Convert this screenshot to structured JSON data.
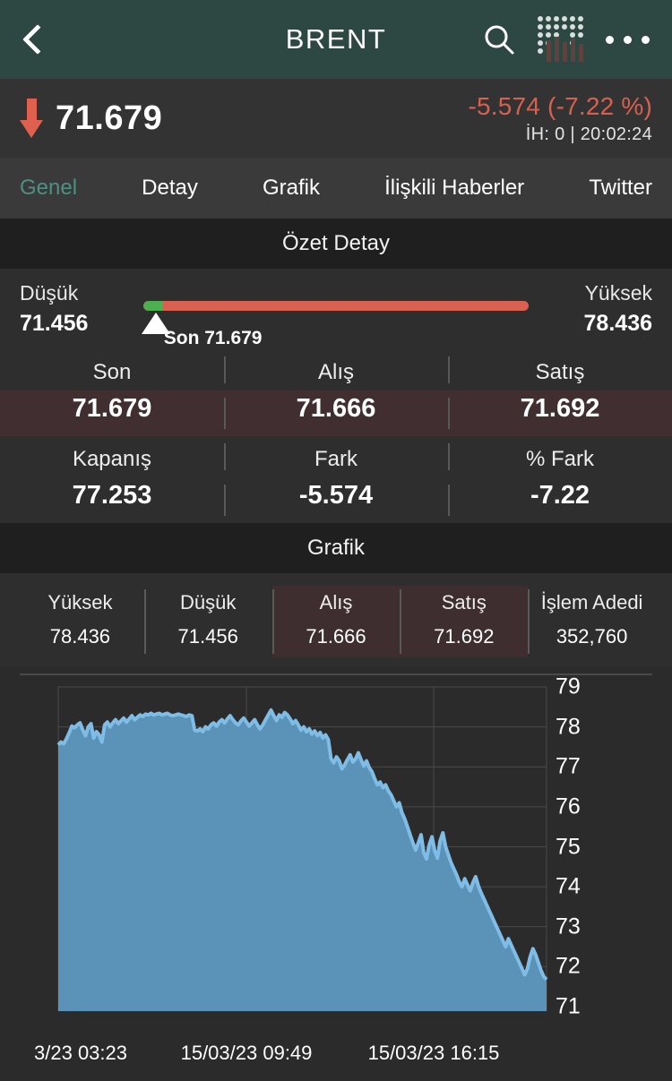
{
  "topbar": {
    "title": "BRENT",
    "back_icon": "chevron-left-icon",
    "search_icon": "search-icon",
    "grid_icon": "matrix-board-icon",
    "more_icon": "more-options-icon"
  },
  "price": {
    "direction_icon": "arrow-down-icon",
    "last": "71.679",
    "change": "-5.574 (-7.22 %)",
    "status": "İH:  0 | 20:02:24",
    "down_color": "#d9604f"
  },
  "tabs": [
    {
      "label": "Genel",
      "active": true
    },
    {
      "label": "Detay",
      "active": false
    },
    {
      "label": "Grafik",
      "active": false
    },
    {
      "label": "İlişkili Haberler",
      "active": false
    },
    {
      "label": "Twitter",
      "active": false
    }
  ],
  "sections": {
    "summary_title": "Özet Detay",
    "chart_title": "Grafik"
  },
  "range": {
    "low_label": "Düşük",
    "low_value": "71.456",
    "high_label": "Yüksek",
    "high_value": "78.436",
    "marker_label": "Son 71.679",
    "marker_percent": 3.2,
    "green_percent": 5,
    "bar_color": "#d96152",
    "green_color": "#4caf50"
  },
  "summary_grid": {
    "row1": [
      {
        "label": "Son",
        "value": "71.679"
      },
      {
        "label": "Alış",
        "value": "71.666"
      },
      {
        "label": "Satış",
        "value": "71.692"
      }
    ],
    "row2": [
      {
        "label": "Kapanış",
        "value": "77.253"
      },
      {
        "label": "Fark",
        "value": "-5.574"
      },
      {
        "label": "% Fark",
        "value": "-7.22"
      }
    ]
  },
  "chart_stats": [
    {
      "label": "Yüksek",
      "value": "78.436",
      "highlight": false
    },
    {
      "label": "Düşük",
      "value": "71.456",
      "highlight": false
    },
    {
      "label": "Alış",
      "value": "71.666",
      "highlight": true
    },
    {
      "label": "Satış",
      "value": "71.692",
      "highlight": true
    },
    {
      "label": "İşlem Adedi",
      "value": "352,760",
      "highlight": false
    }
  ],
  "chart_data": {
    "type": "area",
    "title": "Grafik",
    "xlabel": "",
    "ylabel": "",
    "ylim": [
      70.6,
      79.3
    ],
    "yticks": [
      79,
      78,
      77,
      76,
      75,
      74,
      73,
      72,
      71
    ],
    "ytick_labels": [
      "79",
      "78",
      "77",
      "76",
      "75",
      "74",
      "73",
      "72",
      "71"
    ],
    "xtick_labels": [
      "3/23 03:23",
      "15/03/23 09:49",
      "15/03/23 16:15"
    ],
    "xtick_positions": [
      90,
      275,
      484
    ],
    "grid": true,
    "line_color": "#7fbde6",
    "fill_color": "#5a92b8",
    "series": [
      {
        "name": "BRENT",
        "values": [
          77.55,
          77.62,
          77.58,
          77.7,
          77.85,
          78.02,
          77.98,
          78.05,
          78.1,
          77.92,
          77.78,
          78.0,
          78.08,
          77.72,
          77.88,
          77.8,
          77.62,
          78.05,
          78.12,
          78.0,
          78.1,
          78.18,
          78.08,
          78.15,
          78.22,
          78.12,
          78.2,
          78.28,
          78.18,
          78.24,
          78.3,
          78.26,
          78.32,
          78.3,
          78.34,
          78.3,
          78.32,
          78.34,
          78.3,
          78.32,
          78.34,
          78.3,
          78.28,
          78.3,
          78.32,
          78.3,
          78.28,
          78.26,
          78.3,
          78.28,
          77.92,
          77.9,
          77.95,
          77.88,
          78.0,
          77.95,
          78.05,
          78.1,
          78.02,
          78.12,
          78.18,
          78.1,
          78.2,
          78.28,
          78.18,
          78.1,
          78.05,
          78.15,
          78.22,
          78.12,
          78.02,
          78.1,
          78.18,
          78.05,
          77.95,
          78.05,
          78.18,
          78.3,
          78.42,
          78.28,
          78.16,
          78.3,
          78.24,
          78.36,
          78.3,
          78.2,
          78.08,
          78.16,
          78.05,
          77.92,
          78.0,
          77.88,
          77.95,
          77.82,
          77.9,
          77.78,
          77.86,
          77.72,
          77.8,
          77.68,
          77.2,
          77.1,
          77.25,
          77.15,
          76.95,
          77.05,
          77.18,
          77.3,
          77.12,
          77.2,
          77.35,
          77.18,
          77.02,
          77.15,
          76.98,
          76.88,
          76.7,
          76.55,
          76.62,
          76.48,
          76.55,
          76.4,
          76.3,
          76.15,
          76.0,
          76.1,
          75.85,
          75.7,
          75.5,
          75.3,
          75.1,
          74.92,
          75.1,
          75.3,
          74.85,
          74.7,
          75.05,
          75.25,
          74.9,
          74.72,
          75.15,
          75.35,
          75.0,
          74.8,
          74.6,
          74.45,
          74.3,
          74.12,
          74.0,
          74.2,
          74.05,
          73.9,
          74.1,
          74.25,
          74.02,
          73.85,
          73.7,
          73.55,
          73.4,
          73.25,
          73.1,
          72.95,
          72.8,
          72.65,
          72.5,
          72.7,
          72.55,
          72.4,
          72.25,
          72.1,
          71.95,
          71.8,
          71.95,
          72.25,
          72.45,
          72.3,
          72.1,
          71.9,
          71.75,
          71.68
        ]
      }
    ]
  }
}
